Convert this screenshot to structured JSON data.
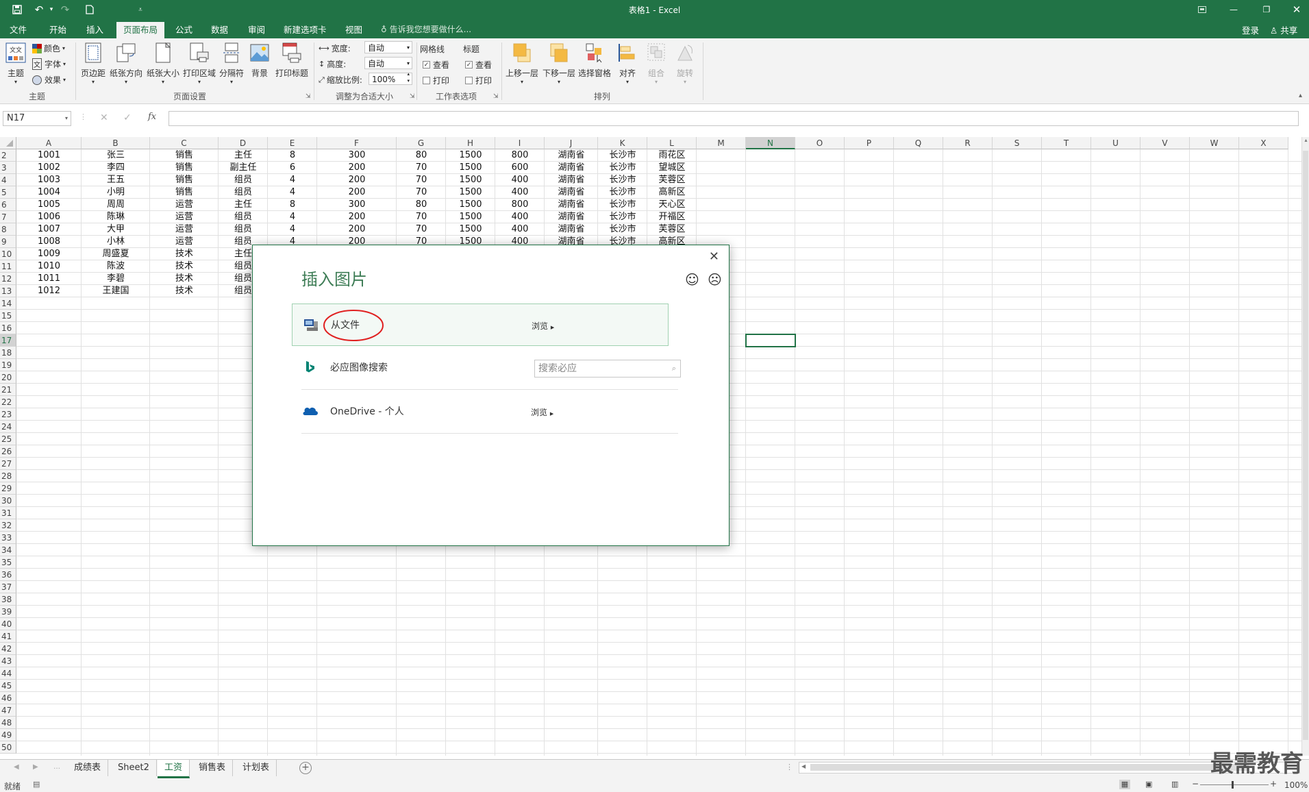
{
  "window": {
    "title": "表格1 - Excel"
  },
  "tabs": [
    "文件",
    "开始",
    "插入",
    "页面布局",
    "公式",
    "数据",
    "审阅",
    "新建选项卡",
    "视图"
  ],
  "active_tab": "页面布局",
  "tell_me": "告诉我您想要做什么...",
  "account": {
    "login": "登录",
    "share": "共享"
  },
  "ribbon": {
    "theme": {
      "label": "主题",
      "colors": "颜色",
      "fonts": "字体",
      "effects": "效果",
      "group": "主题"
    },
    "page_setup": {
      "margins": "页边距",
      "orientation": "纸张方向",
      "size": "纸张大小",
      "print_area": "打印区域",
      "breaks": "分隔符",
      "background": "背景",
      "print_titles": "打印标题",
      "group": "页面设置"
    },
    "scale": {
      "width_label": "宽度:",
      "width_value": "自动",
      "height_label": "高度:",
      "height_value": "自动",
      "scale_label": "缩放比例:",
      "scale_value": "100%",
      "group": "调整为合适大小"
    },
    "sheet_options": {
      "gridlines": "网格线",
      "headings": "标题",
      "view": "查看",
      "print": "打印",
      "group": "工作表选项"
    },
    "arrange": {
      "bring_forward": "上移一层",
      "send_backward": "下移一层",
      "selection_pane": "选择窗格",
      "align": "对齐",
      "group_btn": "组合",
      "rotate": "旋转",
      "group": "排列"
    }
  },
  "formula_bar": {
    "name_box": "N17",
    "fx": "fx"
  },
  "columns": [
    "A",
    "B",
    "C",
    "D",
    "E",
    "F",
    "G",
    "H",
    "I",
    "J",
    "K",
    "L",
    "M",
    "N",
    "O",
    "P",
    "Q",
    "R",
    "S",
    "T",
    "U",
    "V",
    "W",
    "X"
  ],
  "row_numbers": [
    2,
    3,
    4,
    5,
    6,
    7,
    8,
    9,
    10,
    11,
    12,
    13,
    14,
    15,
    16,
    17,
    18,
    19,
    20,
    21,
    22,
    23,
    24,
    25,
    26,
    27,
    28,
    29,
    30,
    31,
    32,
    33,
    34,
    35,
    36,
    37,
    38,
    39,
    40,
    41,
    42,
    43,
    44,
    45,
    46,
    47,
    48,
    49,
    50
  ],
  "rows": [
    [
      "1001",
      "张三",
      "销售",
      "主任",
      "8",
      "300",
      "80",
      "1500",
      "800",
      "湖南省",
      "长沙市",
      "雨花区"
    ],
    [
      "1002",
      "李四",
      "销售",
      "副主任",
      "6",
      "200",
      "70",
      "1500",
      "600",
      "湖南省",
      "长沙市",
      "望城区"
    ],
    [
      "1003",
      "王五",
      "销售",
      "组员",
      "4",
      "200",
      "70",
      "1500",
      "400",
      "湖南省",
      "长沙市",
      "芙蓉区"
    ],
    [
      "1004",
      "小明",
      "销售",
      "组员",
      "4",
      "200",
      "70",
      "1500",
      "400",
      "湖南省",
      "长沙市",
      "高新区"
    ],
    [
      "1005",
      "周周",
      "运营",
      "主任",
      "8",
      "300",
      "80",
      "1500",
      "800",
      "湖南省",
      "长沙市",
      "天心区"
    ],
    [
      "1006",
      "陈琳",
      "运营",
      "组员",
      "4",
      "200",
      "70",
      "1500",
      "400",
      "湖南省",
      "长沙市",
      "开福区"
    ],
    [
      "1007",
      "大甲",
      "运营",
      "组员",
      "4",
      "200",
      "70",
      "1500",
      "400",
      "湖南省",
      "长沙市",
      "芙蓉区"
    ],
    [
      "1008",
      "小林",
      "运营",
      "组员",
      "4",
      "200",
      "70",
      "1500",
      "400",
      "湖南省",
      "长沙市",
      "高新区"
    ],
    [
      "1009",
      "周盛夏",
      "技术",
      "主任"
    ],
    [
      "1010",
      "陈波",
      "技术",
      "组员"
    ],
    [
      "1011",
      "李碧",
      "技术",
      "组员"
    ],
    [
      "1012",
      "王建国",
      "技术",
      "组员"
    ]
  ],
  "sheets": [
    "成绩表",
    "Sheet2",
    "工资",
    "销售表",
    "计划表"
  ],
  "active_sheet": "工资",
  "status": {
    "ready": "就绪",
    "zoom": "100%"
  },
  "dialog": {
    "title": "插入图片",
    "from_file": {
      "label": "从文件",
      "link": "浏览"
    },
    "bing": {
      "label": "必应图像搜索",
      "placeholder": "搜索必应"
    },
    "onedrive": {
      "label": "OneDrive - 个人",
      "link": "浏览"
    }
  },
  "watermark": "最需教育",
  "colors": {
    "excel_green": "#217346",
    "highlight_red": "#e02020"
  }
}
